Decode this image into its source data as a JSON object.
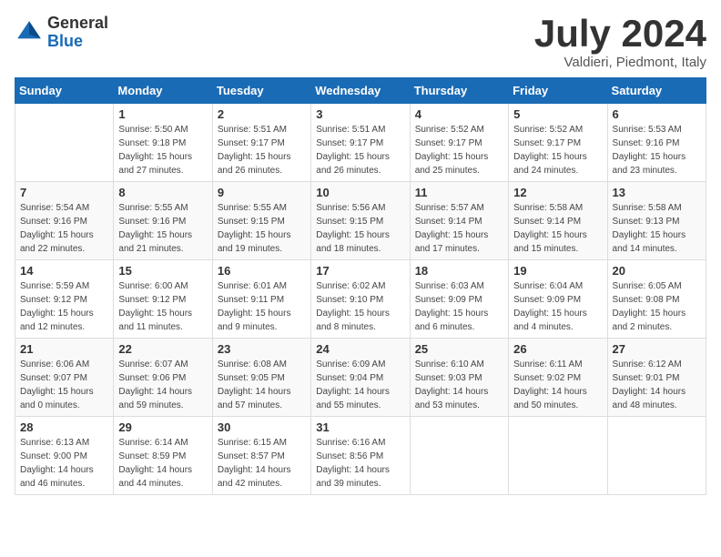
{
  "header": {
    "logo_general": "General",
    "logo_blue": "Blue",
    "month": "July 2024",
    "location": "Valdieri, Piedmont, Italy"
  },
  "weekdays": [
    "Sunday",
    "Monday",
    "Tuesday",
    "Wednesday",
    "Thursday",
    "Friday",
    "Saturday"
  ],
  "weeks": [
    [
      {
        "day": "",
        "sunrise": "",
        "sunset": "",
        "daylight": ""
      },
      {
        "day": "1",
        "sunrise": "Sunrise: 5:50 AM",
        "sunset": "Sunset: 9:18 PM",
        "daylight": "Daylight: 15 hours and 27 minutes."
      },
      {
        "day": "2",
        "sunrise": "Sunrise: 5:51 AM",
        "sunset": "Sunset: 9:17 PM",
        "daylight": "Daylight: 15 hours and 26 minutes."
      },
      {
        "day": "3",
        "sunrise": "Sunrise: 5:51 AM",
        "sunset": "Sunset: 9:17 PM",
        "daylight": "Daylight: 15 hours and 26 minutes."
      },
      {
        "day": "4",
        "sunrise": "Sunrise: 5:52 AM",
        "sunset": "Sunset: 9:17 PM",
        "daylight": "Daylight: 15 hours and 25 minutes."
      },
      {
        "day": "5",
        "sunrise": "Sunrise: 5:52 AM",
        "sunset": "Sunset: 9:17 PM",
        "daylight": "Daylight: 15 hours and 24 minutes."
      },
      {
        "day": "6",
        "sunrise": "Sunrise: 5:53 AM",
        "sunset": "Sunset: 9:16 PM",
        "daylight": "Daylight: 15 hours and 23 minutes."
      }
    ],
    [
      {
        "day": "7",
        "sunrise": "Sunrise: 5:54 AM",
        "sunset": "Sunset: 9:16 PM",
        "daylight": "Daylight: 15 hours and 22 minutes."
      },
      {
        "day": "8",
        "sunrise": "Sunrise: 5:55 AM",
        "sunset": "Sunset: 9:16 PM",
        "daylight": "Daylight: 15 hours and 21 minutes."
      },
      {
        "day": "9",
        "sunrise": "Sunrise: 5:55 AM",
        "sunset": "Sunset: 9:15 PM",
        "daylight": "Daylight: 15 hours and 19 minutes."
      },
      {
        "day": "10",
        "sunrise": "Sunrise: 5:56 AM",
        "sunset": "Sunset: 9:15 PM",
        "daylight": "Daylight: 15 hours and 18 minutes."
      },
      {
        "day": "11",
        "sunrise": "Sunrise: 5:57 AM",
        "sunset": "Sunset: 9:14 PM",
        "daylight": "Daylight: 15 hours and 17 minutes."
      },
      {
        "day": "12",
        "sunrise": "Sunrise: 5:58 AM",
        "sunset": "Sunset: 9:14 PM",
        "daylight": "Daylight: 15 hours and 15 minutes."
      },
      {
        "day": "13",
        "sunrise": "Sunrise: 5:58 AM",
        "sunset": "Sunset: 9:13 PM",
        "daylight": "Daylight: 15 hours and 14 minutes."
      }
    ],
    [
      {
        "day": "14",
        "sunrise": "Sunrise: 5:59 AM",
        "sunset": "Sunset: 9:12 PM",
        "daylight": "Daylight: 15 hours and 12 minutes."
      },
      {
        "day": "15",
        "sunrise": "Sunrise: 6:00 AM",
        "sunset": "Sunset: 9:12 PM",
        "daylight": "Daylight: 15 hours and 11 minutes."
      },
      {
        "day": "16",
        "sunrise": "Sunrise: 6:01 AM",
        "sunset": "Sunset: 9:11 PM",
        "daylight": "Daylight: 15 hours and 9 minutes."
      },
      {
        "day": "17",
        "sunrise": "Sunrise: 6:02 AM",
        "sunset": "Sunset: 9:10 PM",
        "daylight": "Daylight: 15 hours and 8 minutes."
      },
      {
        "day": "18",
        "sunrise": "Sunrise: 6:03 AM",
        "sunset": "Sunset: 9:09 PM",
        "daylight": "Daylight: 15 hours and 6 minutes."
      },
      {
        "day": "19",
        "sunrise": "Sunrise: 6:04 AM",
        "sunset": "Sunset: 9:09 PM",
        "daylight": "Daylight: 15 hours and 4 minutes."
      },
      {
        "day": "20",
        "sunrise": "Sunrise: 6:05 AM",
        "sunset": "Sunset: 9:08 PM",
        "daylight": "Daylight: 15 hours and 2 minutes."
      }
    ],
    [
      {
        "day": "21",
        "sunrise": "Sunrise: 6:06 AM",
        "sunset": "Sunset: 9:07 PM",
        "daylight": "Daylight: 15 hours and 0 minutes."
      },
      {
        "day": "22",
        "sunrise": "Sunrise: 6:07 AM",
        "sunset": "Sunset: 9:06 PM",
        "daylight": "Daylight: 14 hours and 59 minutes."
      },
      {
        "day": "23",
        "sunrise": "Sunrise: 6:08 AM",
        "sunset": "Sunset: 9:05 PM",
        "daylight": "Daylight: 14 hours and 57 minutes."
      },
      {
        "day": "24",
        "sunrise": "Sunrise: 6:09 AM",
        "sunset": "Sunset: 9:04 PM",
        "daylight": "Daylight: 14 hours and 55 minutes."
      },
      {
        "day": "25",
        "sunrise": "Sunrise: 6:10 AM",
        "sunset": "Sunset: 9:03 PM",
        "daylight": "Daylight: 14 hours and 53 minutes."
      },
      {
        "day": "26",
        "sunrise": "Sunrise: 6:11 AM",
        "sunset": "Sunset: 9:02 PM",
        "daylight": "Daylight: 14 hours and 50 minutes."
      },
      {
        "day": "27",
        "sunrise": "Sunrise: 6:12 AM",
        "sunset": "Sunset: 9:01 PM",
        "daylight": "Daylight: 14 hours and 48 minutes."
      }
    ],
    [
      {
        "day": "28",
        "sunrise": "Sunrise: 6:13 AM",
        "sunset": "Sunset: 9:00 PM",
        "daylight": "Daylight: 14 hours and 46 minutes."
      },
      {
        "day": "29",
        "sunrise": "Sunrise: 6:14 AM",
        "sunset": "Sunset: 8:59 PM",
        "daylight": "Daylight: 14 hours and 44 minutes."
      },
      {
        "day": "30",
        "sunrise": "Sunrise: 6:15 AM",
        "sunset": "Sunset: 8:57 PM",
        "daylight": "Daylight: 14 hours and 42 minutes."
      },
      {
        "day": "31",
        "sunrise": "Sunrise: 6:16 AM",
        "sunset": "Sunset: 8:56 PM",
        "daylight": "Daylight: 14 hours and 39 minutes."
      },
      {
        "day": "",
        "sunrise": "",
        "sunset": "",
        "daylight": ""
      },
      {
        "day": "",
        "sunrise": "",
        "sunset": "",
        "daylight": ""
      },
      {
        "day": "",
        "sunrise": "",
        "sunset": "",
        "daylight": ""
      }
    ]
  ]
}
